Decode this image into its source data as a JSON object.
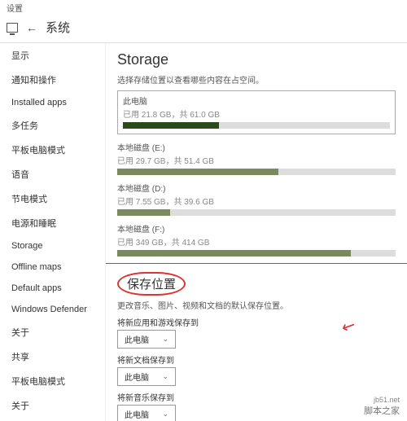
{
  "window_title": "设置",
  "header": {
    "title": "系统"
  },
  "sidebar": {
    "items": [
      "显示",
      "通知和操作",
      "Installed apps",
      "多任务",
      "平板电脑模式",
      "语音",
      "节电模式",
      "电源和睡眠",
      "Storage",
      "Offline maps",
      "Default apps",
      "Windows Defender",
      "关于",
      "共享",
      "平板电脑模式",
      "关于"
    ]
  },
  "storage": {
    "heading": "Storage",
    "description": "选择存储位置以查看哪些内容在占空间。",
    "drives": [
      {
        "name": "此电脑",
        "used_text": "已用 21.8 GB，共 61.0 GB",
        "pct": 36,
        "primary": true
      },
      {
        "name": "本地磁盘 (E:)",
        "used_text": "已用 29.7 GB，共 51.4 GB",
        "pct": 58,
        "primary": false
      },
      {
        "name": "本地磁盘 (D:)",
        "used_text": "已用 7.55 GB，共 39.6 GB",
        "pct": 19,
        "primary": false
      },
      {
        "name": "本地磁盘 (F:)",
        "used_text": "已用 349 GB，共 414 GB",
        "pct": 84,
        "primary": false
      }
    ]
  },
  "save_locations": {
    "heading": "保存位置",
    "description": "更改音乐、图片、视频和文档的默认保存位置。",
    "options": [
      {
        "label": "将新应用和游戏保存到",
        "value": "此电脑"
      },
      {
        "label": "将新文档保存到",
        "value": "此电脑"
      },
      {
        "label": "将新音乐保存到",
        "value": "此电脑"
      }
    ]
  },
  "watermark": {
    "url": "jb51.net",
    "label": "脚本之家"
  },
  "colors": {
    "annotation": "#d33",
    "bar_primary": "#2b4a1a",
    "bar_secondary": "#7b8a5e"
  }
}
